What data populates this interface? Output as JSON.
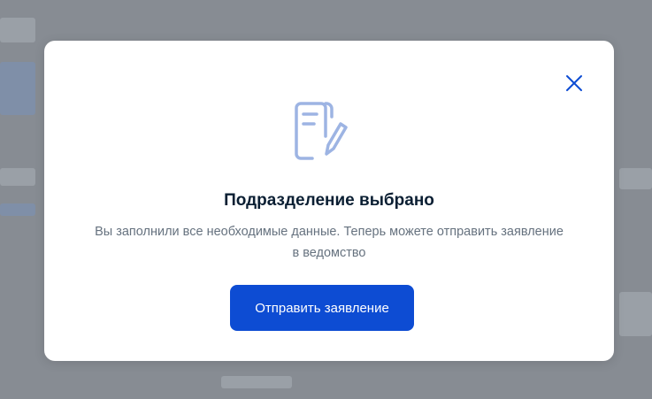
{
  "modal": {
    "title": "Подразделение выбрано",
    "description": "Вы заполнили все необходимые данные. Теперь можете отправить заявление в ведомство",
    "submit_label": "Отправить заявление",
    "close_icon": "close-icon",
    "main_icon": "document-edit-icon"
  },
  "colors": {
    "backdrop": "#878c93",
    "modal_bg": "#ffffff",
    "title": "#0b1f33",
    "description": "#66727f",
    "button_bg": "#0d4cd3",
    "button_text": "#ffffff",
    "close_icon": "#0d4cd3",
    "doc_icon": "#9db4e3"
  }
}
